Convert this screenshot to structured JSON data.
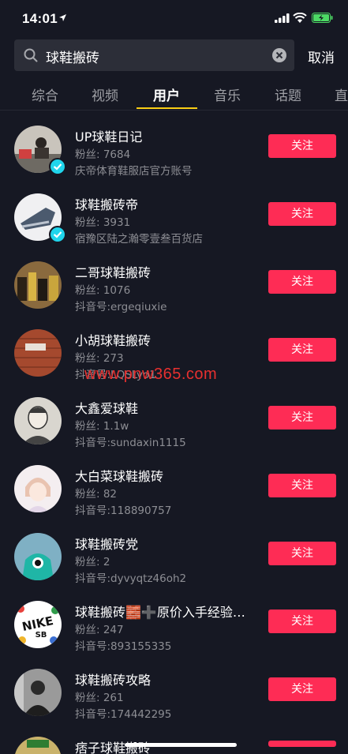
{
  "status_bar": {
    "time": "14:01"
  },
  "search": {
    "query": "球鞋搬砖",
    "cancel_label": "取消"
  },
  "tabs": [
    {
      "label": "综合",
      "active": false
    },
    {
      "label": "视频",
      "active": false
    },
    {
      "label": "用户",
      "active": true
    },
    {
      "label": "音乐",
      "active": false
    },
    {
      "label": "话题",
      "active": false
    },
    {
      "label": "直",
      "active": false
    }
  ],
  "users": [
    {
      "name": "UP球鞋日记",
      "fans": "粉丝: 7684",
      "sub": "庆帝体育鞋服店官方账号",
      "verified": true,
      "follow_label": "关注"
    },
    {
      "name": "球鞋搬砖帝",
      "fans": "粉丝: 3931",
      "sub": "宿豫区陆之瀚零壹叁百货店",
      "verified": true,
      "follow_label": "关注"
    },
    {
      "name": "二哥球鞋搬砖",
      "fans": "粉丝: 1076",
      "sub": "抖音号:ergeqiuxie",
      "verified": false,
      "follow_label": "关注"
    },
    {
      "name": "小胡球鞋搬砖",
      "fans": "粉丝: 273",
      "sub": "抖音号:LQSLyo1",
      "verified": false,
      "follow_label": "关注"
    },
    {
      "name": "大鑫爱球鞋",
      "fans": "粉丝: 1.1w",
      "sub": "抖音号:sundaxin1115",
      "verified": false,
      "follow_label": "关注"
    },
    {
      "name": "大白菜球鞋搬砖",
      "fans": "粉丝: 82",
      "sub": "抖音号:118890757",
      "verified": false,
      "follow_label": "关注"
    },
    {
      "name": "球鞋搬砖党",
      "fans": "粉丝: 2",
      "sub": "抖音号:dyvyqtz46oh2",
      "verified": false,
      "follow_label": "关注"
    },
    {
      "name": "球鞋搬砖🧱➕原价入手经验…",
      "fans": "粉丝: 247",
      "sub": "抖音号:893155335",
      "verified": false,
      "follow_label": "关注"
    },
    {
      "name": "球鞋搬砖攻略",
      "fans": "粉丝: 261",
      "sub": "抖音号:174442295",
      "verified": false,
      "follow_label": "关注"
    },
    {
      "name": "痞子球鞋搬砖",
      "fans": "",
      "sub": "",
      "verified": false,
      "follow_label": ""
    }
  ],
  "watermark": "www.pnw365.com",
  "colors": {
    "background": "#161823",
    "follow_button": "#fe2c55",
    "tab_indicator": "#face15",
    "verified_badge": "#20d5ec",
    "watermark": "#e8302f"
  }
}
